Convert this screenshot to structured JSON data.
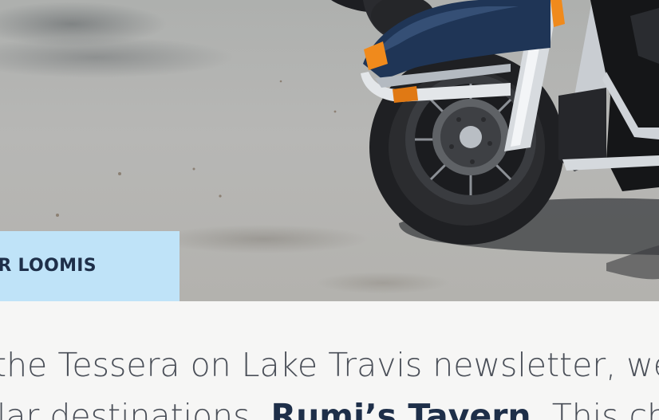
{
  "hero": {
    "image_subject": "motorcycle-front-wheel",
    "colors": {
      "asphalt": "#b5b5b3",
      "fender": "#1f3556",
      "chrome": "#d9dde1",
      "tire": "#222326",
      "turn_signal": "#f08a1c"
    }
  },
  "author": {
    "name": "ER LOOMIS",
    "tag_color": "#bfe3f8",
    "text_color": "#1e2f49"
  },
  "article": {
    "line1": "the Tessera on Lake Travis newsletter, we p",
    "line2_prefix": "ular destinations, ",
    "line2_strong": "Rumi’s Tavern",
    "line2_suffix": ". This cha"
  }
}
